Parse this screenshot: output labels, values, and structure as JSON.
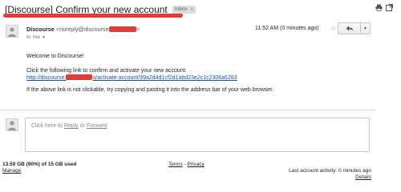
{
  "email": {
    "subject": "[Discourse] Confirm your new account",
    "label": "Inbox",
    "label_remove": "x",
    "sender_name": "Discourse",
    "sender_email_prefix": "<noreply@discourse",
    "sender_email_suffix": ">",
    "to": "to me",
    "time": "11:52 AM (0 minutes ago)",
    "body": {
      "greeting": "Welcome to Discourse!",
      "instruction": "Click the following link to confirm and activate your new account:",
      "link_prefix": "http://discourse.",
      "link_suffix": "u/activate-account/99a2d4d1cf2d1abd23e2c1c2306a6283",
      "fallback": "If the above link is not clickable, try copying and pasting it into the address bar of your web browser."
    }
  },
  "reply_box": {
    "prefix": "Click here to ",
    "reply": "Reply",
    "or": " or ",
    "forward": "Forward"
  },
  "footer": {
    "storage": "13.59 GB (90%) of 15 GB used",
    "manage": "Manage",
    "terms": "Terms",
    "separator": " - ",
    "privacy": "Privacy",
    "last_activity": "Last account activity: 0 minutes ago",
    "details": "Details"
  },
  "icons": {
    "print": "print-icon",
    "new_window": "new-window-icon",
    "reply": "reply-icon",
    "star": "star-icon",
    "more": "chevron-down-icon"
  },
  "colors": {
    "redaction": "#e23b3b",
    "link": "#1a4fa8"
  }
}
